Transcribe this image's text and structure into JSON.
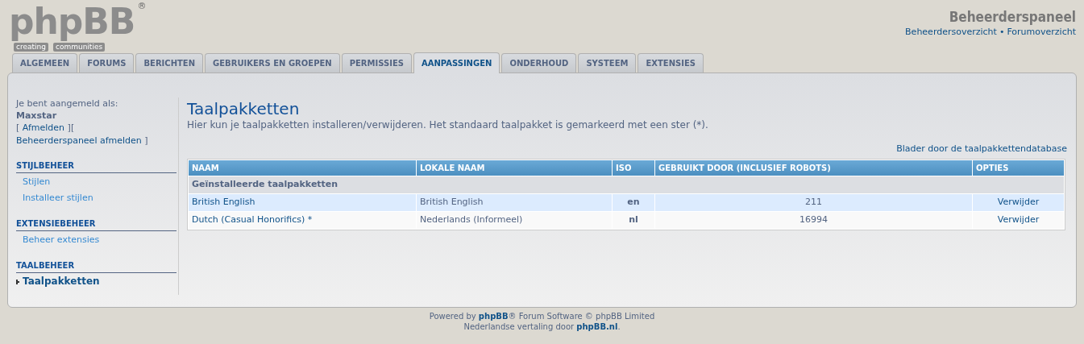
{
  "logo": {
    "wordmark": "phpBB",
    "registered": "®",
    "tagline": [
      "creating",
      "communities"
    ]
  },
  "header": {
    "title": "Beheerderspaneel",
    "links": [
      "Beheerdersoverzicht",
      "Forumoverzicht"
    ],
    "separator": "•"
  },
  "tabs": [
    {
      "label": "ALGEMEEN",
      "selected": false
    },
    {
      "label": "FORUMS",
      "selected": false
    },
    {
      "label": "BERICHTEN",
      "selected": false
    },
    {
      "label": "GEBRUIKERS EN GROEPEN",
      "selected": false
    },
    {
      "label": "PERMISSIES",
      "selected": false
    },
    {
      "label": "AANPASSINGEN",
      "selected": true
    },
    {
      "label": "ONDERHOUD",
      "selected": false
    },
    {
      "label": "SYSTEEM",
      "selected": false
    },
    {
      "label": "EXTENSIES",
      "selected": false
    }
  ],
  "sidebar": {
    "login_label": "Je bent aangemeld als:",
    "username": "Maxstar",
    "login_links": [
      {
        "before": "[ ",
        "link": "Afmelden",
        "after": " ]"
      },
      {
        "before": "[ ",
        "link": "Beheerderspaneel afmelden",
        "after": " ]"
      }
    ],
    "sections": [
      {
        "title": "STIJLBEHEER",
        "items": [
          {
            "label": "Stijlen",
            "selected": false
          },
          {
            "label": "Installeer stijlen",
            "selected": false
          }
        ]
      },
      {
        "title": "EXTENSIEBEHEER",
        "items": [
          {
            "label": "Beheer extensies",
            "selected": false
          }
        ]
      },
      {
        "title": "TAALBEHEER",
        "items": [
          {
            "label": "Taalpakketten",
            "selected": true
          }
        ]
      }
    ]
  },
  "content": {
    "title": "Taalpakketten",
    "description": "Hier kun je taalpakketten installeren/verwijderen. Het standaard taalpakket is gemarkeerd met een ster (*).",
    "browse_link": "Blader door de taalpakkettendatabase",
    "table": {
      "columns": [
        "NAAM",
        "LOKALE NAAM",
        "ISO",
        "GEBRUIKT DOOR (INCLUSIEF ROBOTS)",
        "OPTIES"
      ],
      "rows": [
        {
          "kind": "group",
          "label": "Geïnstalleerde taalpakketten"
        },
        {
          "kind": "pack",
          "name": "British English",
          "local_name": "British English",
          "iso": "en",
          "used_by": "211",
          "option": "Verwijder"
        },
        {
          "kind": "pack",
          "name": "Dutch (Casual Honorifics) *",
          "local_name": "Nederlands (Informeel)",
          "iso": "nl",
          "used_by": "16994",
          "option": "Verwijder"
        }
      ]
    }
  },
  "footer": [
    {
      "before": "Powered by ",
      "link": "phpBB",
      "after": "® Forum Software © phpBB Limited"
    },
    {
      "before": "Nederlandse vertaling door ",
      "link": "phpBB.nl",
      "after": "."
    }
  ]
}
